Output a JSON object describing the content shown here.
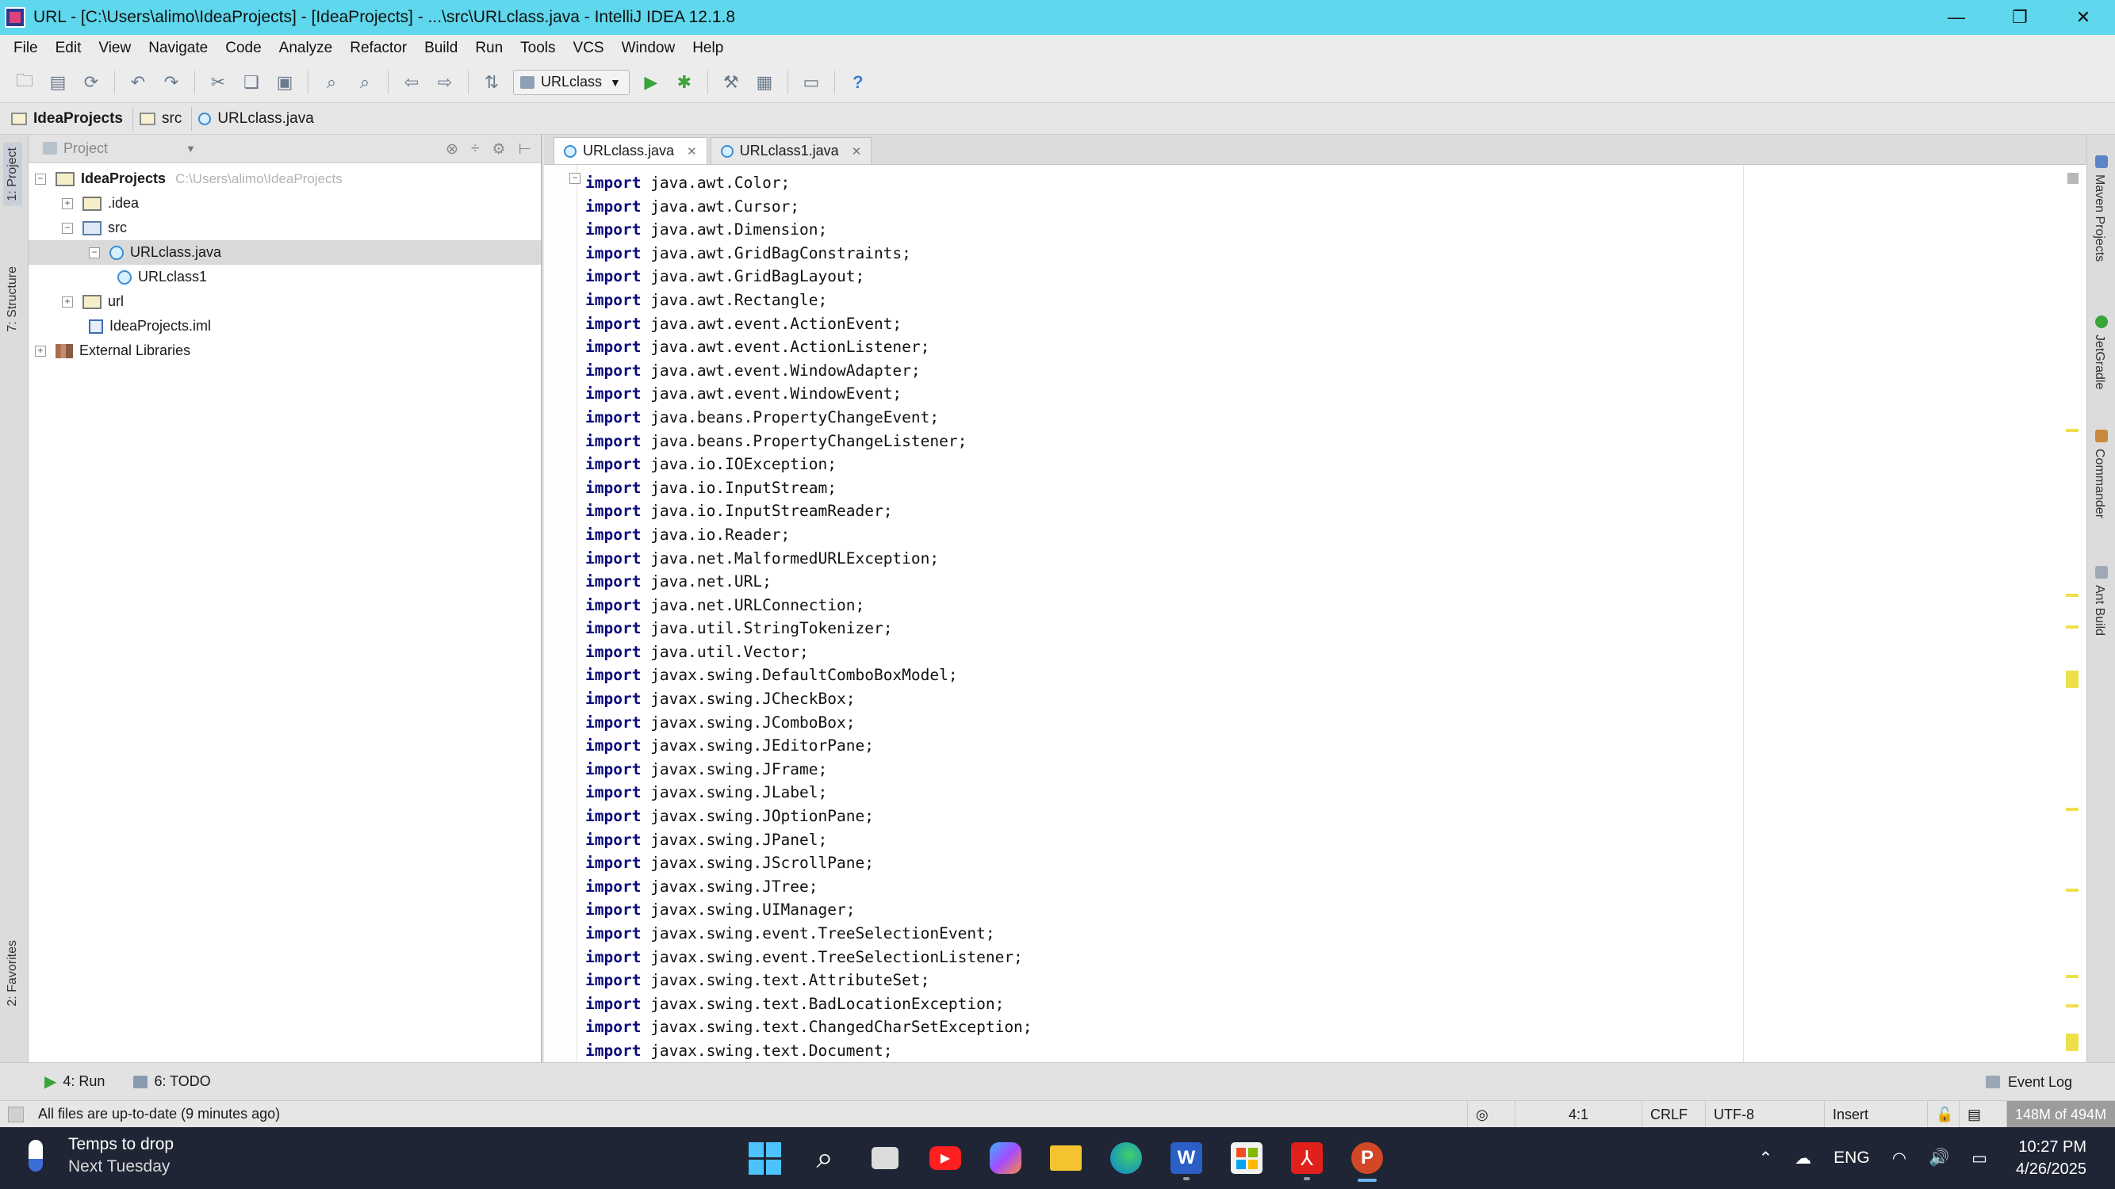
{
  "window": {
    "title": "URL - [C:\\Users\\alimo\\IdeaProjects] - [IdeaProjects] - ...\\src\\URLclass.java - IntelliJ IDEA 12.1.8",
    "minimize": "—",
    "restore": "❐",
    "close": "✕"
  },
  "menu": [
    "File",
    "Edit",
    "View",
    "Navigate",
    "Code",
    "Analyze",
    "Refactor",
    "Build",
    "Run",
    "Tools",
    "VCS",
    "Window",
    "Help"
  ],
  "toolbar": {
    "run_config": "URLclass"
  },
  "breadcrumb": [
    "IdeaProjects",
    "src",
    "URLclass.java"
  ],
  "left_strip": {
    "project_tab": "1: Project",
    "structure_tab": "7: Structure",
    "favorites_tab": "2: Favorites"
  },
  "project_panel": {
    "view_selector": "Project",
    "tree": {
      "root_label": "IdeaProjects",
      "root_path": "C:\\Users\\alimo\\IdeaProjects",
      "idea": ".idea",
      "src": "src",
      "urlclass_java": "URLclass.java",
      "urlclass1": "URLclass1",
      "url": "url",
      "iml": "IdeaProjects.iml",
      "external": "External Libraries"
    }
  },
  "editor": {
    "tabs": [
      "URLclass.java",
      "URLclass1.java"
    ],
    "keyword": "import",
    "imports": [
      "java.awt.Color;",
      "java.awt.Cursor;",
      "java.awt.Dimension;",
      "java.awt.GridBagConstraints;",
      "java.awt.GridBagLayout;",
      "java.awt.Rectangle;",
      "java.awt.event.ActionEvent;",
      "java.awt.event.ActionListener;",
      "java.awt.event.WindowAdapter;",
      "java.awt.event.WindowEvent;",
      "java.beans.PropertyChangeEvent;",
      "java.beans.PropertyChangeListener;",
      "java.io.IOException;",
      "java.io.InputStream;",
      "java.io.InputStreamReader;",
      "java.io.Reader;",
      "java.net.MalformedURLException;",
      "java.net.URL;",
      "java.net.URLConnection;",
      "java.util.StringTokenizer;",
      "java.util.Vector;",
      "javax.swing.DefaultComboBoxModel;",
      "javax.swing.JCheckBox;",
      "javax.swing.JComboBox;",
      "javax.swing.JEditorPane;",
      "javax.swing.JFrame;",
      "javax.swing.JLabel;",
      "javax.swing.JOptionPane;",
      "javax.swing.JPanel;",
      "javax.swing.JScrollPane;",
      "javax.swing.JTree;",
      "javax.swing.UIManager;",
      "javax.swing.event.TreeSelectionEvent;",
      "javax.swing.event.TreeSelectionListener;",
      "javax.swing.text.AttributeSet;",
      "javax.swing.text.BadLocationException;",
      "javax.swing.text.ChangedCharSetException;",
      "javax.swing.text.Document;"
    ]
  },
  "right_strip": {
    "maven": "Maven Projects",
    "jetgradle": "JetGradle",
    "commander": "Commander",
    "ant": "Ant Build"
  },
  "bottom_tools": {
    "run": "4: Run",
    "todo": "6: TODO",
    "event_log": "Event Log"
  },
  "status": {
    "message": "All files are up-to-date (9 minutes ago)",
    "position": "4:1",
    "line_sep": "CRLF",
    "encoding": "UTF-8",
    "mode": "Insert",
    "memory": "148M of 494M"
  },
  "taskbar": {
    "weather_line1": "Temps to drop",
    "weather_line2": "Next Tuesday",
    "lang": "ENG",
    "time": "10:27 PM",
    "date": "4/26/2025"
  },
  "colors": {
    "titlebar": "#5fd7ec",
    "keyword": "#0a0a7a",
    "taskbar": "#1f2534",
    "warning_marker": "#ede04a"
  }
}
